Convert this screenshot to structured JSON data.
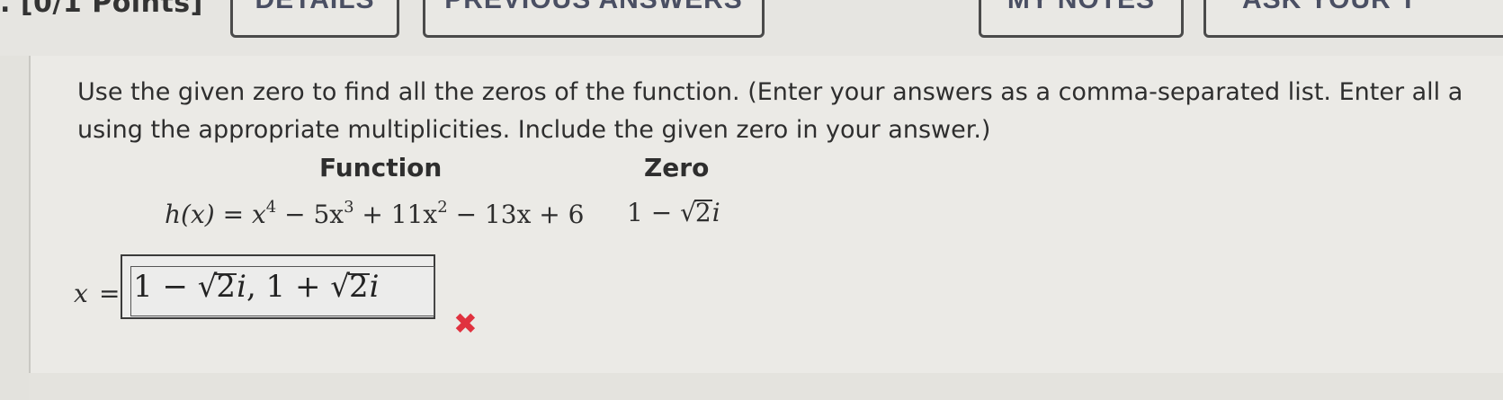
{
  "header": {
    "points_text": ". [0/1 Points]",
    "details_label": "DETAILS",
    "previous_answers_label": "PREVIOUS ANSWERS",
    "my_notes_label": "MY NOTES",
    "ask_teacher_label": "ASK YOUR T"
  },
  "question": {
    "instruction_line1": "Use the given zero to find all the zeros of the function. (Enter your answers as a comma-separated list. Enter all a",
    "instruction_line2": "using the appropriate multiplicities. Include the given zero in your answer.)",
    "function_header": "Function",
    "zero_header": "Zero",
    "function_lhs": "h(x)",
    "function_rhs_parts": [
      "x",
      "4",
      " − 5x",
      "3",
      " + 11x",
      "2",
      " − 13x + 6"
    ],
    "zero_prefix": "1 − ",
    "zero_radicand": "2",
    "zero_suffix": "i"
  },
  "answer": {
    "label": "x",
    "equals": "=",
    "value_parts": [
      "1 − ",
      "2",
      "i",
      ", 1 + ",
      "2",
      "i"
    ],
    "status_icon": "wrong-x-icon",
    "status_color": "#e0323f"
  }
}
